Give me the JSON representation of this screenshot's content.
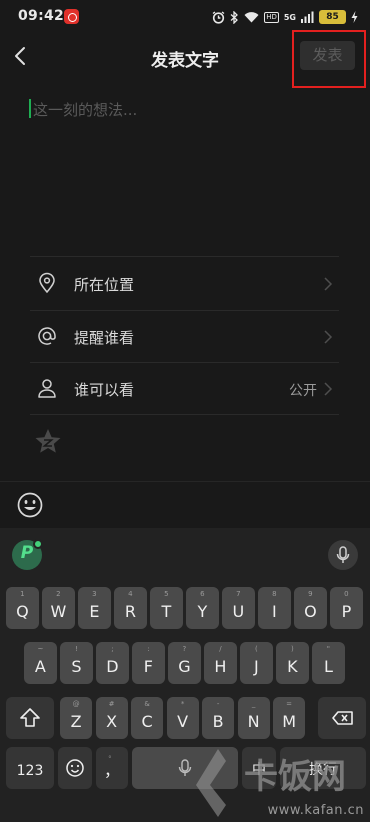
{
  "status_bar": {
    "time": "09:42",
    "battery": "85",
    "network": "5G",
    "hd": "HD"
  },
  "header": {
    "title": "发表文字",
    "publish_label": "发表"
  },
  "compose": {
    "placeholder": "这一刻的想法..."
  },
  "options": [
    {
      "label": "所在位置",
      "value": ""
    },
    {
      "label": "提醒谁看",
      "value": ""
    },
    {
      "label": "谁可以看",
      "value": "公开"
    }
  ],
  "keyboard": {
    "row1": [
      {
        "key": "Q",
        "sub": "1"
      },
      {
        "key": "W",
        "sub": "2"
      },
      {
        "key": "E",
        "sub": "3"
      },
      {
        "key": "R",
        "sub": "4"
      },
      {
        "key": "T",
        "sub": "5"
      },
      {
        "key": "Y",
        "sub": "6"
      },
      {
        "key": "U",
        "sub": "7"
      },
      {
        "key": "I",
        "sub": "8"
      },
      {
        "key": "O",
        "sub": "9"
      },
      {
        "key": "P",
        "sub": "0"
      }
    ],
    "row2": [
      {
        "key": "A",
        "sub": "~"
      },
      {
        "key": "S",
        "sub": "!"
      },
      {
        "key": "D",
        "sub": ";"
      },
      {
        "key": "F",
        "sub": ":"
      },
      {
        "key": "G",
        "sub": "?"
      },
      {
        "key": "H",
        "sub": "/"
      },
      {
        "key": "J",
        "sub": "("
      },
      {
        "key": "K",
        "sub": ")"
      },
      {
        "key": "L",
        "sub": "\""
      }
    ],
    "row3": [
      {
        "key": "Z",
        "sub": "@"
      },
      {
        "key": "X",
        "sub": "#"
      },
      {
        "key": "C",
        "sub": "&"
      },
      {
        "key": "V",
        "sub": "*"
      },
      {
        "key": "B",
        "sub": "-"
      },
      {
        "key": "N",
        "sub": "_"
      },
      {
        "key": "M",
        "sub": "="
      }
    ],
    "num_label": "123",
    "comma_label": "，",
    "comma_sub": "。",
    "lang_label": "中",
    "enter_label": "换行"
  },
  "watermark": {
    "brand": "卡饭网",
    "url": "www.kafan.cn"
  },
  "colors": {
    "background": "#191919",
    "keyboard_bg": "#222222",
    "key_bg": "#4a4a4a",
    "accent_green": "#1fae53",
    "highlight_red": "#e3201f"
  }
}
